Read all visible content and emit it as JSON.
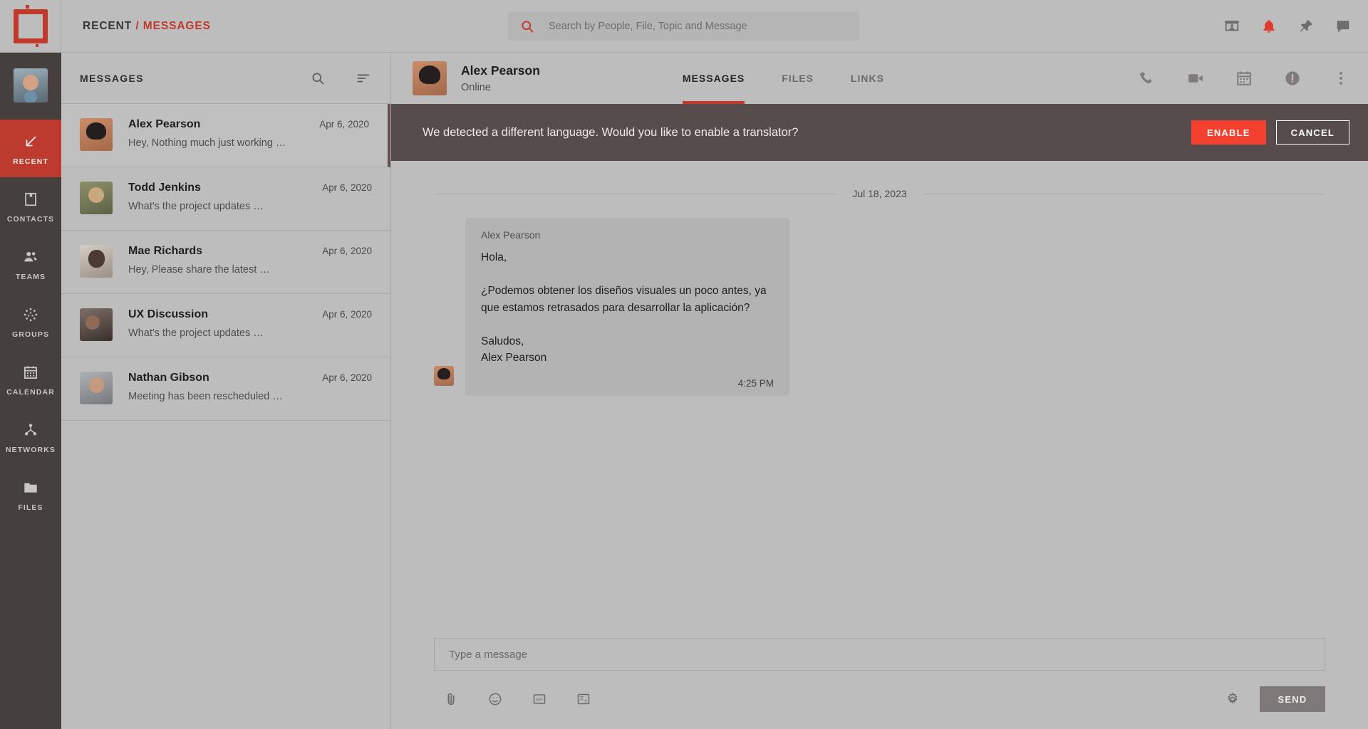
{
  "header": {
    "logo_name": "app-logo",
    "breadcrumb": {
      "section": "RECENT",
      "separator": "/",
      "current": "MESSAGES"
    },
    "search": {
      "placeholder": "Search by People, File, Topic and Message",
      "value": ""
    },
    "actions": [
      {
        "name": "presentation-icon",
        "label": "Presentation"
      },
      {
        "name": "bell-icon",
        "label": "Notifications"
      },
      {
        "name": "pin-icon",
        "label": "Pinned"
      },
      {
        "name": "chat-bubble-icon",
        "label": "Chat"
      }
    ]
  },
  "sidebar": {
    "avatar_name": "user-avatar",
    "items": [
      {
        "label": "RECENT",
        "icon": "arrow-down-left-icon",
        "active": true
      },
      {
        "label": "CONTACTS",
        "icon": "contacts-book-icon",
        "active": false
      },
      {
        "label": "TEAMS",
        "icon": "people-icon",
        "active": false
      },
      {
        "label": "GROUPS",
        "icon": "dotted-circle-icon",
        "active": false
      },
      {
        "label": "CALENDAR",
        "icon": "calendar-icon",
        "active": false
      },
      {
        "label": "NETWORKS",
        "icon": "network-nodes-icon",
        "active": false
      },
      {
        "label": "FILES",
        "icon": "folder-icon",
        "active": false
      }
    ]
  },
  "list_panel": {
    "title": "MESSAGES",
    "search_icon": "search-icon",
    "sort_icon": "sort-filter-icon",
    "conversations": [
      {
        "name": "Alex Pearson",
        "date": "Apr 6, 2020",
        "preview": "Hey, Nothing much just working …",
        "active": true
      },
      {
        "name": "Todd Jenkins",
        "date": "Apr 6, 2020",
        "preview": "What's the project updates …",
        "active": false
      },
      {
        "name": "Mae Richards",
        "date": "Apr 6, 2020",
        "preview": "Hey, Please share the latest …",
        "active": false
      },
      {
        "name": "UX Discussion",
        "date": "Apr 6, 2020",
        "preview": "What's the project updates …",
        "active": false
      },
      {
        "name": "Nathan Gibson",
        "date": "Apr 6, 2020",
        "preview": "Meeting has been rescheduled …",
        "active": false
      }
    ]
  },
  "chat": {
    "peer_name": "Alex Pearson",
    "peer_status": "Online",
    "tabs": [
      {
        "label": "MESSAGES",
        "active": true
      },
      {
        "label": "FILES",
        "active": false
      },
      {
        "label": "LINKS",
        "active": false
      }
    ],
    "actions": [
      {
        "name": "phone-icon",
        "label": "Call"
      },
      {
        "name": "video-camera-icon",
        "label": "Video call"
      },
      {
        "name": "calendar-icon",
        "label": "Schedule"
      },
      {
        "name": "info-icon",
        "label": "Info"
      },
      {
        "name": "more-vertical-icon",
        "label": "More"
      }
    ],
    "banner": {
      "text": "We detected a different language. Would you like to enable a translator?",
      "enable_label": "ENABLE",
      "cancel_label": "CANCEL",
      "background": "#574c4c",
      "enable_color": "#f4412f"
    },
    "date_divider": "Jul 18, 2023",
    "messages": [
      {
        "sender": "Alex Pearson",
        "text": "Hola,\n\n¿Podemos obtener los diseños visuales un poco antes, ya que estamos retrasados para desarrollar la aplicación?\n\nSaludos,\nAlex Pearson",
        "time": "4:25 PM"
      }
    ],
    "composer": {
      "placeholder": "Type a message",
      "value": "",
      "tools": [
        {
          "name": "paperclip-icon",
          "label": "Attach"
        },
        {
          "name": "emoji-icon",
          "label": "Emoji"
        },
        {
          "name": "gif-icon",
          "label": "GIF"
        },
        {
          "name": "translate-icon",
          "label": "Translate"
        }
      ],
      "settings_icon": "gear-icon",
      "send_label": "SEND"
    }
  },
  "theme": {
    "accent_red": "#c0392b",
    "bright_red": "#f4412f",
    "rail_dark": "#453f3e",
    "page_bg": "#bdbdbd"
  }
}
